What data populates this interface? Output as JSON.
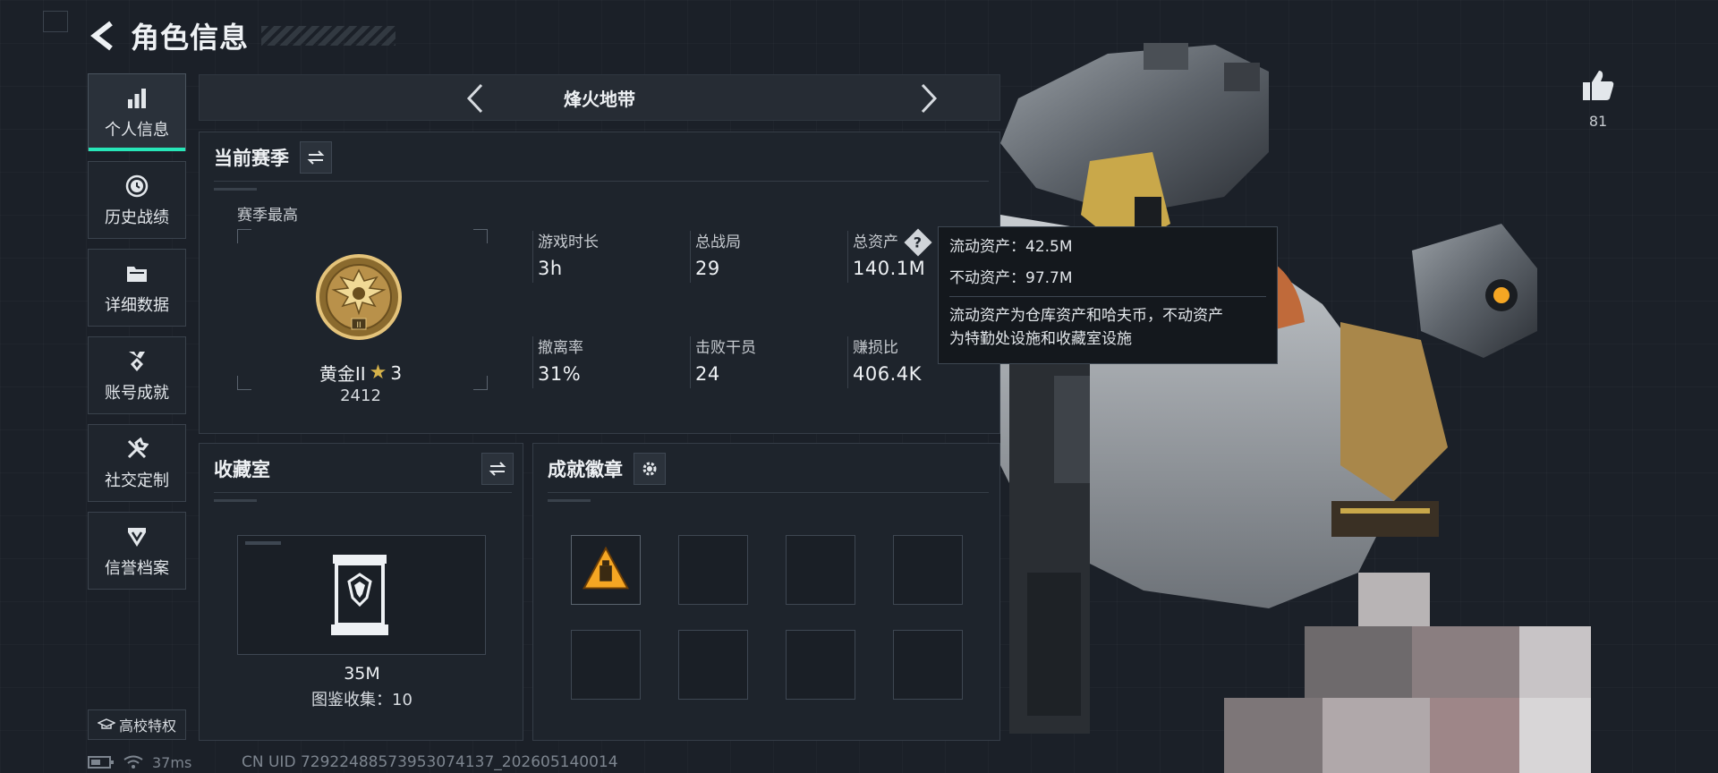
{
  "header": {
    "title": "角色信息",
    "back_icon": "back-arrow-icon"
  },
  "sidebar": {
    "items": [
      {
        "label": "个人信息",
        "icon": "bar-chart-icon",
        "active": true
      },
      {
        "label": "历史战绩",
        "icon": "clock-icon",
        "active": false
      },
      {
        "label": "详细数据",
        "icon": "folder-icon",
        "active": false
      },
      {
        "label": "账号成就",
        "icon": "medal-icon",
        "active": false
      },
      {
        "label": "社交定制",
        "icon": "wrench-icon",
        "active": false
      },
      {
        "label": "信誉档案",
        "icon": "shield-icon",
        "active": false
      }
    ],
    "school_button": "高校特权"
  },
  "mode_bar": {
    "title": "烽火地带"
  },
  "season": {
    "title": "当前赛季",
    "rank_label": "赛季最高",
    "rank_name": "黄金II",
    "rank_stars": "3",
    "rank_points": "2412",
    "stats": [
      {
        "label": "游戏时长",
        "value": "3h"
      },
      {
        "label": "总战局",
        "value": "29"
      },
      {
        "label": "总资产",
        "value": "140.1M"
      },
      {
        "label": "撤离率",
        "value": "31%"
      },
      {
        "label": "击败干员",
        "value": "24"
      },
      {
        "label": "赚损比",
        "value": "406.4K"
      }
    ]
  },
  "tooltip": {
    "liquid": "流动资产：42.5M",
    "fixed": "不动资产：97.7M",
    "desc_line1": "流动资产为仓库资产和哈夫币，不动资产",
    "desc_line2": "为特勤处设施和收藏室设施"
  },
  "collection": {
    "title": "收藏室",
    "value": "35M",
    "count": "图鉴收集：10"
  },
  "achievements": {
    "title": "成就徽章",
    "slots_filled": 1,
    "slots_total": 8
  },
  "likes": {
    "count": "81"
  },
  "status": {
    "ping": "37ms",
    "uid": "CN UID 7292248857395307413​7_202605140014"
  },
  "colors": {
    "accent": "#27e6b8",
    "gold": "#d6b24a",
    "orange": "#f5a623"
  }
}
